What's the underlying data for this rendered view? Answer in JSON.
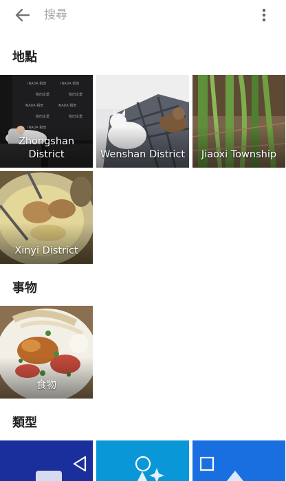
{
  "search": {
    "placeholder": "搜尋",
    "value": ""
  },
  "sections": {
    "places": {
      "title": "地點",
      "items": [
        {
          "label": "Zhongshan District"
        },
        {
          "label": "Wenshan District"
        },
        {
          "label": "Jiaoxi Township"
        },
        {
          "label": "Xinyi District"
        }
      ]
    },
    "things": {
      "title": "事物",
      "items": [
        {
          "label": "食物"
        }
      ]
    },
    "types": {
      "title": "類型"
    }
  },
  "icons": {
    "back": "arrow-back-icon",
    "more": "more-vert-icon",
    "nav_back": "triangle-back-icon",
    "nav_home": "circle-home-icon",
    "nav_recents": "square-recents-icon"
  },
  "colors": {
    "type_tile_1": "#1a2f9c",
    "type_tile_2": "#0a97d8",
    "type_tile_3": "#1a6fe0"
  }
}
